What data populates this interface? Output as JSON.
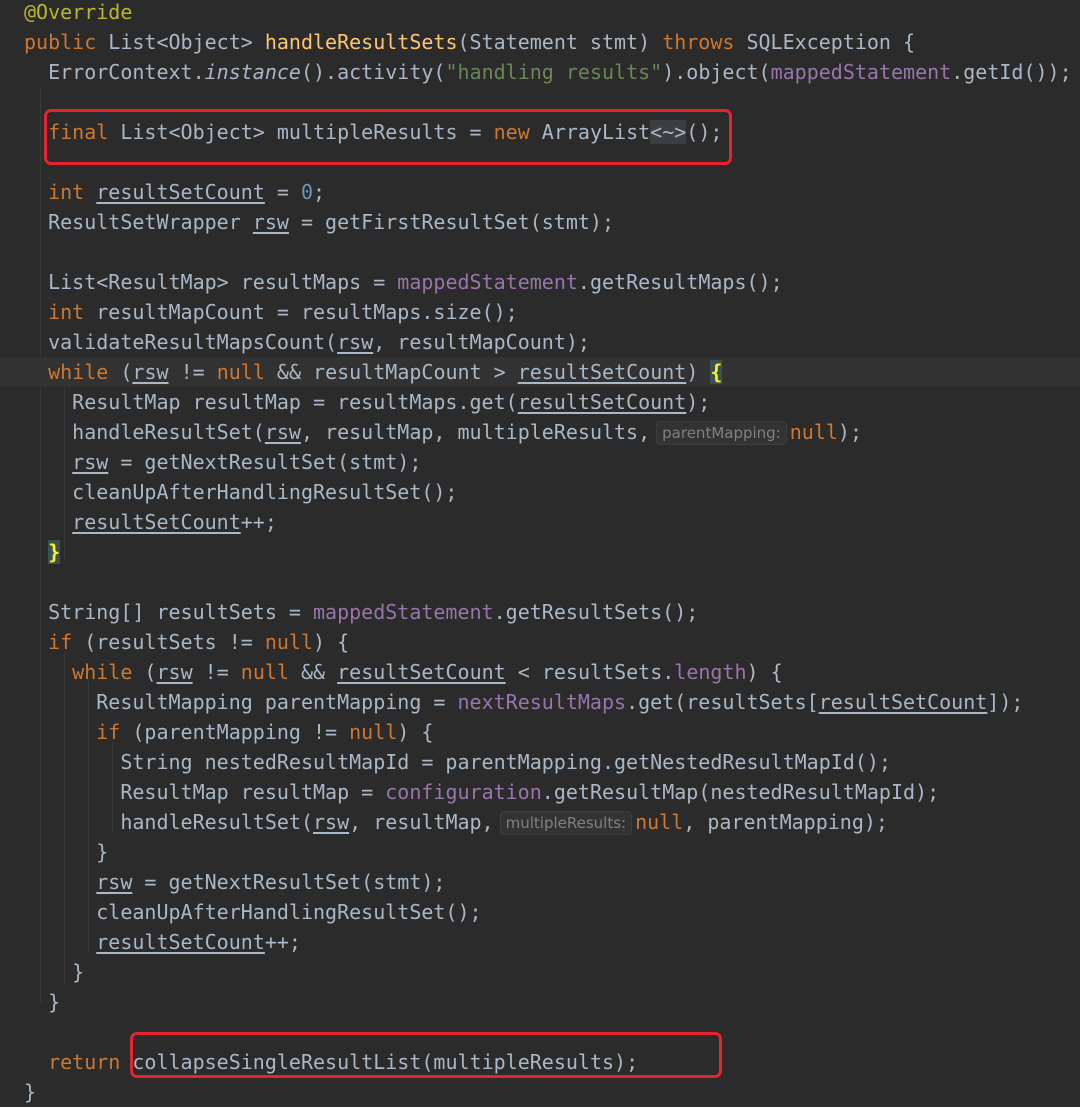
{
  "editor": {
    "theme_colors": {
      "background": "#2b2b2b",
      "keyword": "#cc7832",
      "annotation": "#bbb529",
      "method_declaration": "#ffc66d",
      "string": "#6a8759",
      "field": "#9876aa",
      "number": "#6897bb",
      "default_text": "#a9b7c6",
      "highlight_box": "#e8232f"
    },
    "lines": [
      [
        [
          "@Override",
          "ann"
        ]
      ],
      [
        [
          "public",
          "kw"
        ],
        [
          " List<Object> "
        ],
        [
          "handleResultSets",
          "fn"
        ],
        [
          "(Statement stmt) "
        ],
        [
          "throws",
          "kw"
        ],
        [
          " SQLException {"
        ]
      ],
      [
        [
          "  ErrorContext."
        ],
        [
          "instance",
          "it"
        ],
        [
          "().activity("
        ],
        [
          "\"handling results\"",
          "str"
        ],
        [
          ").object("
        ],
        [
          "mappedStatement",
          "field"
        ],
        [
          ".getId());"
        ]
      ],
      [],
      [
        [
          "  "
        ],
        [
          "final",
          "kw"
        ],
        [
          " List<Object> multipleResults = "
        ],
        [
          "new",
          "kw"
        ],
        [
          " ArrayList"
        ],
        [
          "<~>",
          "diamond"
        ],
        [
          "();"
        ]
      ],
      [],
      [
        [
          "  "
        ],
        [
          "int",
          "kw"
        ],
        [
          " "
        ],
        [
          "resultSetCount",
          "ul"
        ],
        [
          " = "
        ],
        [
          "0",
          "num"
        ],
        [
          ";"
        ]
      ],
      [
        [
          "  ResultSetWrapper "
        ],
        [
          "rsw",
          "ul"
        ],
        [
          " = getFirstResultSet(stmt);"
        ]
      ],
      [],
      [
        [
          "  List<ResultMap> resultMaps = "
        ],
        [
          "mappedStatement",
          "field"
        ],
        [
          ".getResultMaps();"
        ]
      ],
      [
        [
          "  "
        ],
        [
          "int",
          "kw"
        ],
        [
          " resultMapCount = resultMaps.size();"
        ]
      ],
      [
        [
          "  validateResultMapsCount("
        ],
        [
          "rsw",
          "ul"
        ],
        [
          ", resultMapCount);"
        ]
      ],
      [
        [
          "  "
        ],
        [
          "while",
          "kw"
        ],
        [
          " ("
        ],
        [
          "rsw",
          "ul"
        ],
        [
          " != "
        ],
        [
          "null",
          "kw"
        ],
        [
          " && resultMapCount > "
        ],
        [
          "resultSetCount",
          "ul"
        ],
        [
          ") "
        ],
        [
          "{",
          "brace"
        ]
      ],
      [
        [
          "    ResultMap resultMap = resultMaps.get("
        ],
        [
          "resultSetCount",
          "ul"
        ],
        [
          ");"
        ]
      ],
      [
        [
          "    handleResultSet("
        ],
        [
          "rsw",
          "ul"
        ],
        [
          ", resultMap, multipleResults,"
        ],
        [
          "parentMapping:",
          "hint"
        ],
        [
          "null",
          "kw"
        ],
        [
          ");"
        ]
      ],
      [
        [
          "    "
        ],
        [
          "rsw",
          "ul"
        ],
        [
          " = getNextResultSet(stmt);"
        ]
      ],
      [
        [
          "    cleanUpAfterHandlingResultSet();"
        ]
      ],
      [
        [
          "    "
        ],
        [
          "resultSetCount",
          "ul"
        ],
        [
          "++;"
        ]
      ],
      [
        [
          "  "
        ],
        [
          "}",
          "brace"
        ]
      ],
      [],
      [
        [
          "  String[] resultSets = "
        ],
        [
          "mappedStatement",
          "field"
        ],
        [
          ".getResultSets();"
        ]
      ],
      [
        [
          "  "
        ],
        [
          "if",
          "kw"
        ],
        [
          " (resultSets != "
        ],
        [
          "null",
          "kw"
        ],
        [
          ") {"
        ]
      ],
      [
        [
          "    "
        ],
        [
          "while",
          "kw"
        ],
        [
          " ("
        ],
        [
          "rsw",
          "ul"
        ],
        [
          " != "
        ],
        [
          "null",
          "kw"
        ],
        [
          " && "
        ],
        [
          "resultSetCount",
          "ul"
        ],
        [
          " < resultSets."
        ],
        [
          "length",
          "field"
        ],
        [
          ") {"
        ]
      ],
      [
        [
          "      ResultMapping parentMapping = "
        ],
        [
          "nextResultMaps",
          "field"
        ],
        [
          ".get(resultSets["
        ],
        [
          "resultSetCount",
          "ul"
        ],
        [
          "]);"
        ]
      ],
      [
        [
          "      "
        ],
        [
          "if",
          "kw"
        ],
        [
          " (parentMapping != "
        ],
        [
          "null",
          "kw"
        ],
        [
          ") {"
        ]
      ],
      [
        [
          "        String nestedResultMapId = parentMapping.getNestedResultMapId();"
        ]
      ],
      [
        [
          "        ResultMap resultMap = "
        ],
        [
          "configuration",
          "field"
        ],
        [
          ".getResultMap(nestedResultMapId);"
        ]
      ],
      [
        [
          "        handleResultSet("
        ],
        [
          "rsw",
          "ul"
        ],
        [
          ", resultMap,"
        ],
        [
          "multipleResults:",
          "hint"
        ],
        [
          "null",
          "kw"
        ],
        [
          ", parentMapping);"
        ]
      ],
      [
        [
          "      }"
        ]
      ],
      [
        [
          "      "
        ],
        [
          "rsw",
          "ul"
        ],
        [
          " = getNextResultSet(stmt);"
        ]
      ],
      [
        [
          "      cleanUpAfterHandlingResultSet();"
        ]
      ],
      [
        [
          "      "
        ],
        [
          "resultSetCount",
          "ul"
        ],
        [
          "++;"
        ]
      ],
      [
        [
          "    }"
        ]
      ],
      [
        [
          "  }"
        ]
      ],
      [],
      [
        [
          "  "
        ],
        [
          "return",
          "kw"
        ],
        [
          " collapseSingleResultList(multipleResults);"
        ]
      ],
      [
        [
          "}"
        ]
      ]
    ]
  }
}
